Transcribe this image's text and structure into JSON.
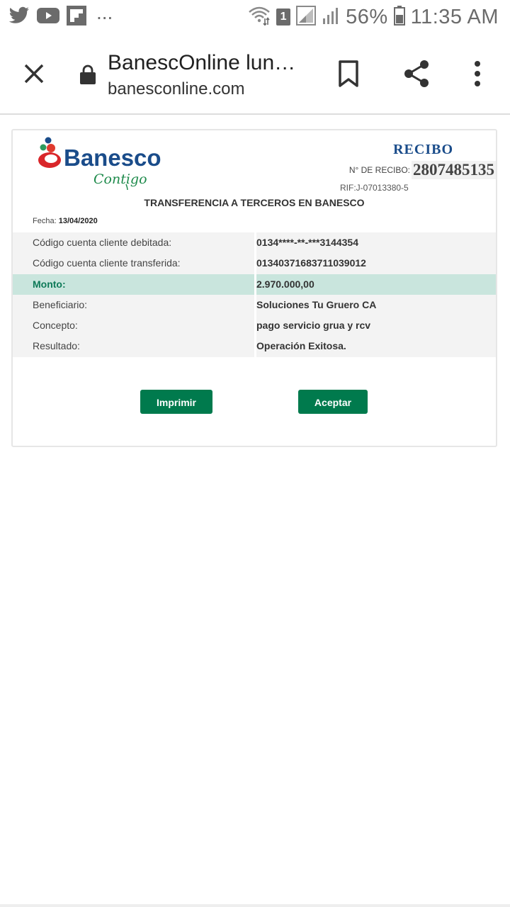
{
  "status_bar": {
    "notification_icons": [
      "twitter-icon",
      "youtube-icon",
      "flipboard-icon"
    ],
    "more": "...",
    "sim_badge": "1",
    "battery_percent": "56%",
    "time": "11:35 AM"
  },
  "toolbar": {
    "title": "BanescOnline lun…",
    "url": "banesconline.com"
  },
  "receipt": {
    "heading": "RECIBO",
    "number_label": "N° DE RECIBO:",
    "number": "2807485135",
    "rif": "RIF:J-07013380-5",
    "transaction_title": "TRANSFERENCIA A TERCEROS EN BANESCO",
    "fecha_label": "Fecha:",
    "fecha_value": "13/04/2020",
    "rows": [
      {
        "label": "Código cuenta cliente debitada:",
        "value": "0134****-**-***3144354"
      },
      {
        "label": "Código cuenta cliente transferida:",
        "value": "01340371683711039012"
      },
      {
        "label": "Monto:",
        "value": "2.970.000,00"
      },
      {
        "label": "Beneficiario:",
        "value": "Soluciones Tu Gruero CA"
      },
      {
        "label": "Concepto:",
        "value": "pago servicio grua y rcv"
      },
      {
        "label": "Resultado:",
        "value": "Operación Exitosa."
      }
    ],
    "buttons": {
      "print": "Imprimir",
      "accept": "Aceptar"
    }
  },
  "logo": {
    "brand": "Banesco",
    "tagline": "Contigo"
  },
  "colors": {
    "brand_green": "#007a4d",
    "brand_blue": "#1a4c8a",
    "highlight_row": "#c9e5dd"
  }
}
